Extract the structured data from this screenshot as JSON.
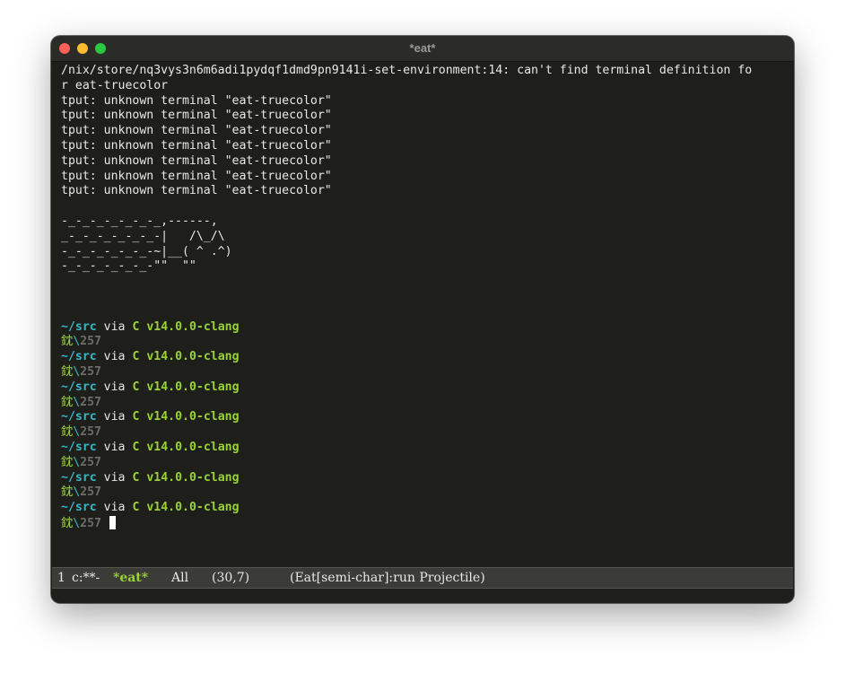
{
  "window": {
    "title": "*eat*"
  },
  "terminal": {
    "error_lines": [
      "/nix/store/nq3vys3n6m6adi1pydqf1dmd9pn9141i-set-environment:14: can't find terminal definition fo",
      "r eat-truecolor",
      "tput: unknown terminal \"eat-truecolor\"",
      "tput: unknown terminal \"eat-truecolor\"",
      "tput: unknown terminal \"eat-truecolor\"",
      "tput: unknown terminal \"eat-truecolor\"",
      "tput: unknown terminal \"eat-truecolor\"",
      "tput: unknown terminal \"eat-truecolor\"",
      "tput: unknown terminal \"eat-truecolor\""
    ],
    "ascii_art": [
      "-_-_-_-_-_-_-_,------,",
      "_-_-_-_-_-_-_-|   /\\_/\\",
      "-_-_-_-_-_-_-~|__( ^ .^)",
      "-_-_-_-_-_-_-\"\"  \"\""
    ],
    "prompt": {
      "path": "~/src",
      "via": "via",
      "lang_icon": "C",
      "version": "v14.0.0-clang",
      "char": "鈂",
      "slash": "\\",
      "exit_code": "257"
    },
    "prompt_count": 7
  },
  "modeline": {
    "window_number": "1",
    "status": "c:**-",
    "buffer_name": "*eat*",
    "position": "All",
    "line_col": "(30,7)",
    "mode": "(Eat[semi-char]:run Projectile)"
  },
  "colors": {
    "background": "#1e1f1b",
    "path": "#36b7c8",
    "accent_green": "#9bd23a",
    "muted": "#6d6d67"
  }
}
